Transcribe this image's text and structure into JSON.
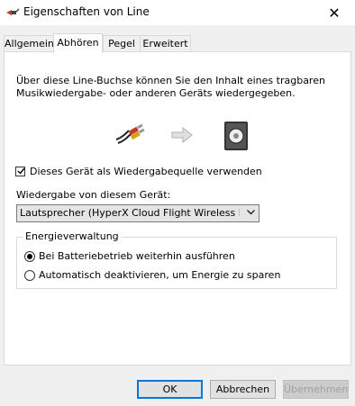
{
  "window": {
    "title": "Eigenschaften von Line"
  },
  "tabs": [
    {
      "label": "Allgemein",
      "active": false
    },
    {
      "label": "Abhören",
      "active": true
    },
    {
      "label": "Pegel",
      "active": false
    },
    {
      "label": "Erweitert",
      "active": false
    }
  ],
  "listen": {
    "description_line1": "Über diese Line-Buchse können Sie den Inhalt eines tragbaren",
    "description_line2": "Musikwiedergabe- oder anderen Geräts wiedergegeben.",
    "listen_checkbox_label": "Dieses Gerät als Wiedergabequelle verwenden",
    "listen_checked": true,
    "playback_label": "Wiedergabe von diesem Gerät:",
    "playback_device": "Lautsprecher (HyperX Cloud Flight Wireless Headset)"
  },
  "power": {
    "group_title": "Energieverwaltung",
    "option1": "Bei Batteriebetrieb weiterhin ausführen",
    "option2": "Automatisch deaktivieren, um Energie zu sparen",
    "selected": 1
  },
  "buttons": {
    "ok": "OK",
    "cancel": "Abbrechen",
    "apply": "Übernehmen"
  },
  "colors": {
    "accent": "#0078d7",
    "disabled_text": "#a0a0a0"
  }
}
